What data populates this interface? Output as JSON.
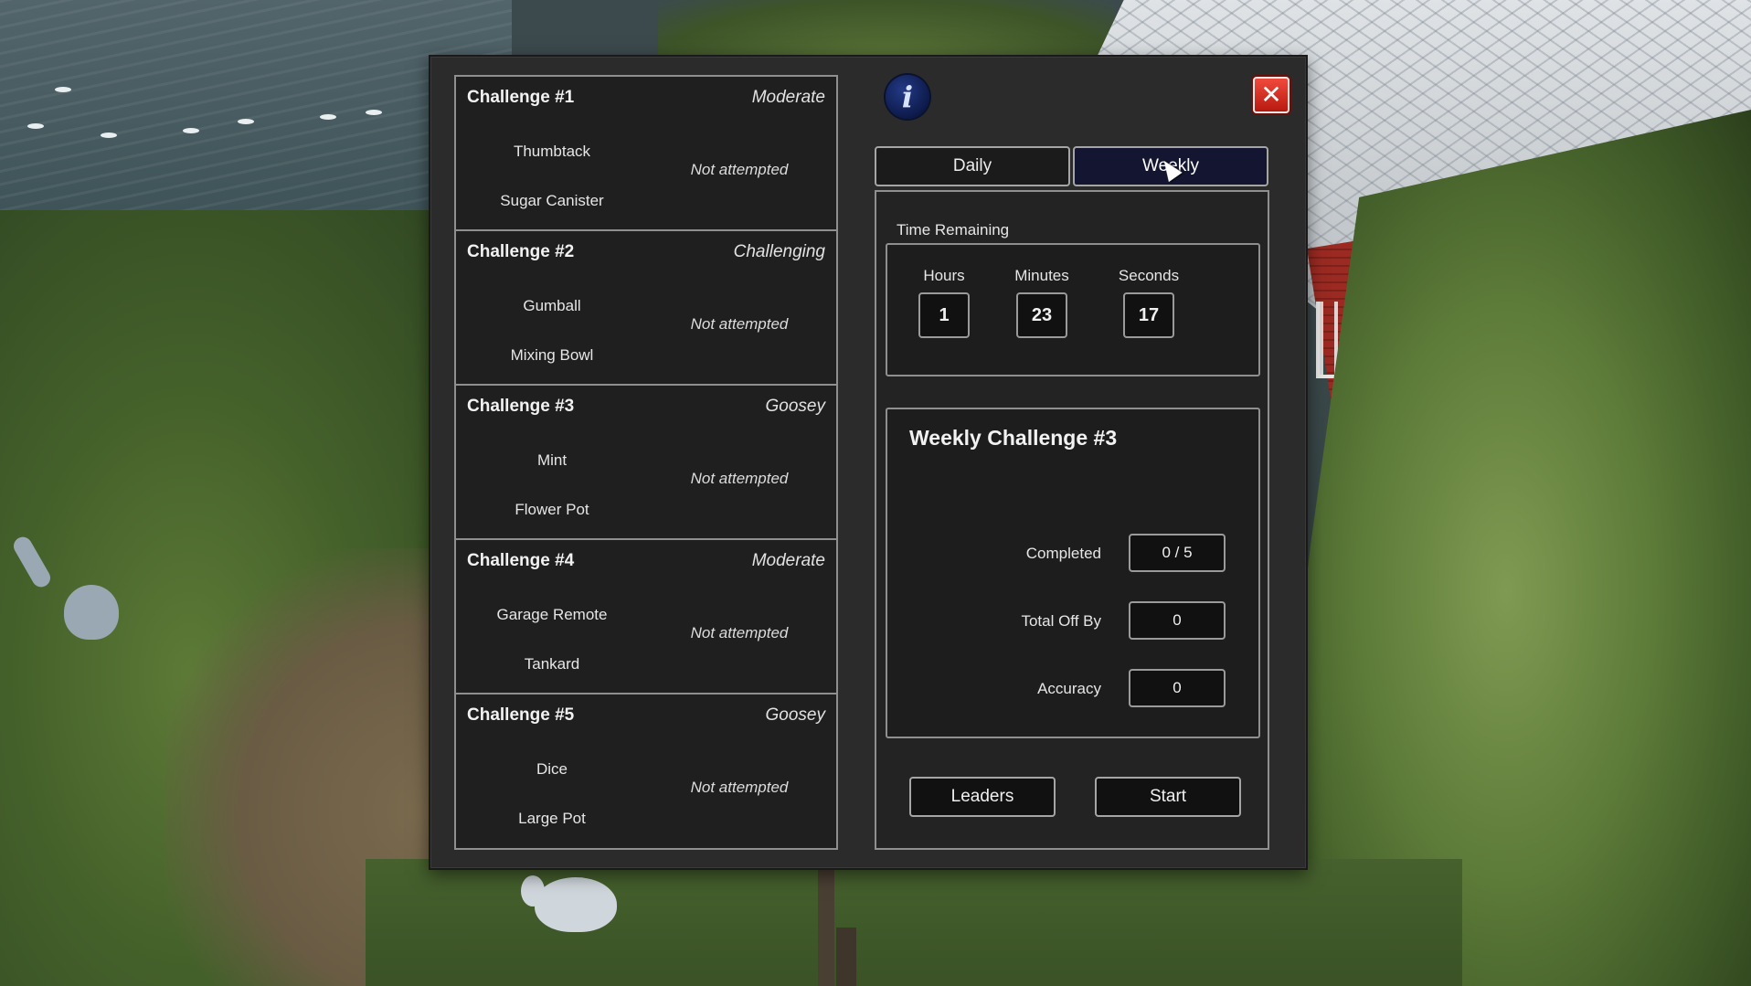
{
  "challenges": [
    {
      "title": "Challenge #1",
      "difficulty": "Moderate",
      "item1": "Thumbtack",
      "item2": "Sugar Canister",
      "status": "Not attempted"
    },
    {
      "title": "Challenge #2",
      "difficulty": "Challenging",
      "item1": "Gumball",
      "item2": "Mixing Bowl",
      "status": "Not attempted"
    },
    {
      "title": "Challenge #3",
      "difficulty": "Goosey",
      "item1": "Mint",
      "item2": "Flower Pot",
      "status": "Not attempted"
    },
    {
      "title": "Challenge #4",
      "difficulty": "Moderate",
      "item1": "Garage Remote",
      "item2": "Tankard",
      "status": "Not attempted"
    },
    {
      "title": "Challenge #5",
      "difficulty": "Goosey",
      "item1": "Dice",
      "item2": "Large Pot",
      "status": "Not attempted"
    }
  ],
  "icons": {
    "info": "info-icon",
    "close": "close-icon"
  },
  "info_glyph": "i",
  "close_glyph": "✕",
  "tabs": {
    "daily": "Daily",
    "weekly": "Weekly",
    "active": "weekly"
  },
  "time_remaining": {
    "label": "Time Remaining",
    "hours_label": "Hours",
    "hours": "1",
    "minutes_label": "Minutes",
    "minutes": "23",
    "seconds_label": "Seconds",
    "seconds": "17"
  },
  "weekly": {
    "title": "Weekly Challenge #3",
    "completed_label": "Completed",
    "completed": "0 / 5",
    "total_off_label": "Total Off By",
    "total_off": "0",
    "accuracy_label": "Accuracy",
    "accuracy": "0"
  },
  "buttons": {
    "leaders": "Leaders",
    "start": "Start"
  },
  "colors": {
    "active_tab": "#141631",
    "close_red": "#d62a1e",
    "info_blue": "#0d1a4a"
  }
}
